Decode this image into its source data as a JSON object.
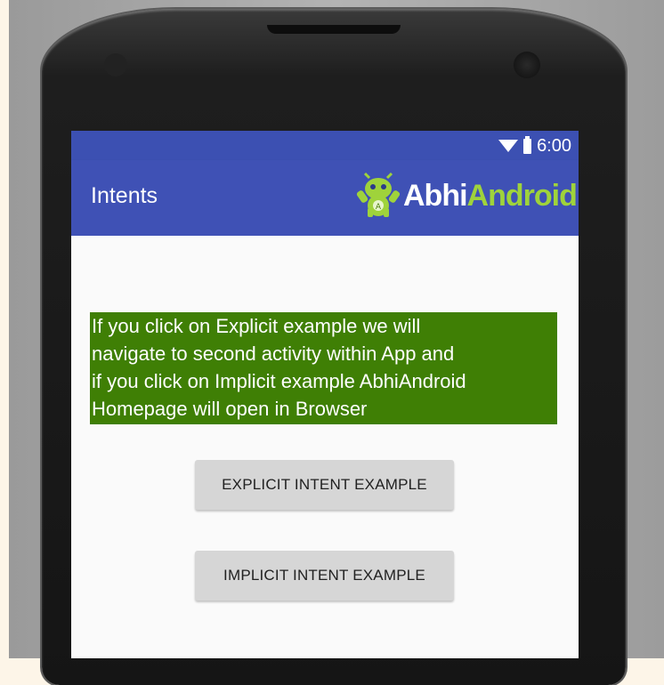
{
  "statusbar": {
    "time": "6:00"
  },
  "appbar": {
    "title": "Intents",
    "logo": {
      "part1": "Abhi",
      "part2": "Android"
    }
  },
  "content": {
    "info_text": "If you click on Explicit example we will\nnavigate to second activity within App and\nif you click on Implicit example AbhiAndroid\nHomepage will open in Browser",
    "explicit_button": "EXPLICIT INTENT EXAMPLE",
    "implicit_button": "IMPLICIT INTENT EXAMPLE"
  },
  "colors": {
    "status_bar": "#3c50b2",
    "app_bar": "#3f51b5",
    "info_background": "#3f7f05",
    "logo_android": "#9fd33b",
    "button": "#d6d6d6"
  },
  "icons": [
    "wifi-icon",
    "battery-icon",
    "android-mascot-icon"
  ]
}
